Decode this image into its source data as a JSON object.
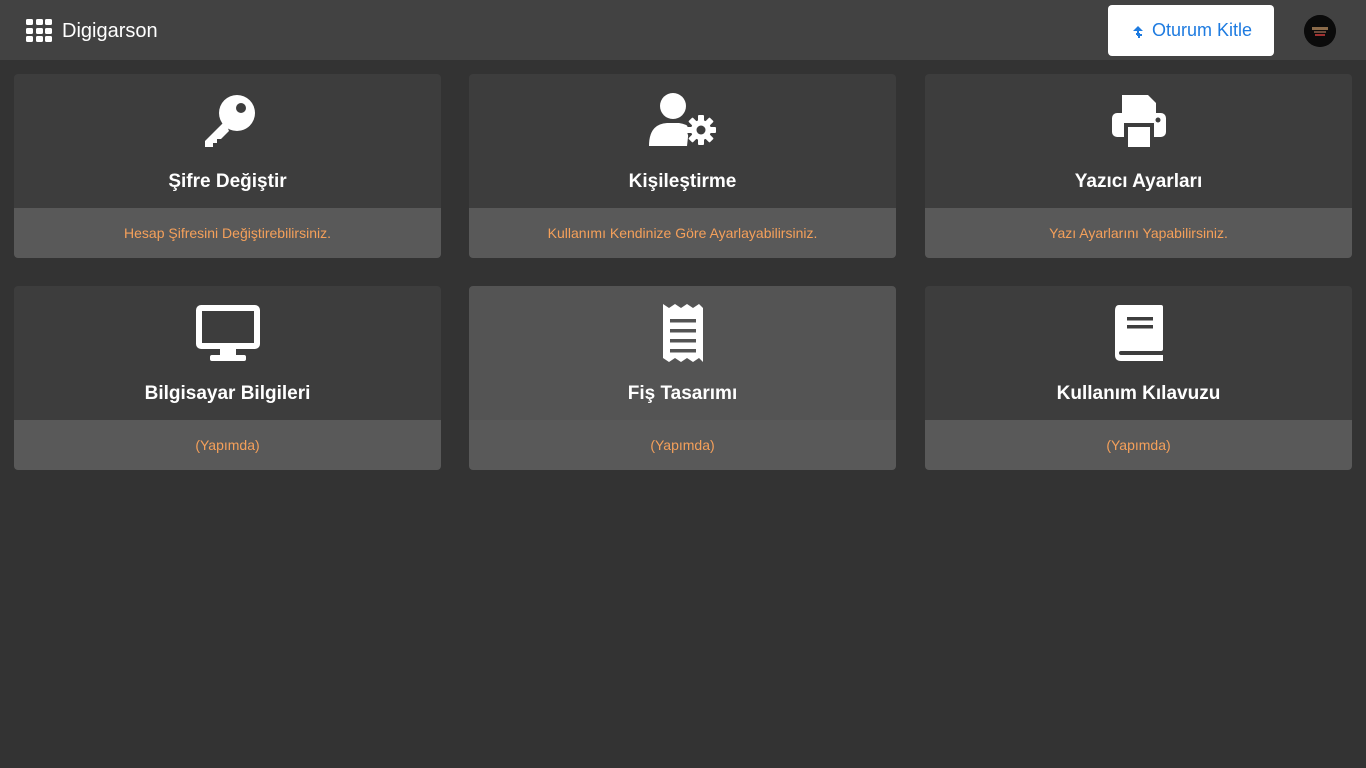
{
  "header": {
    "app_name": "Digigarson",
    "lock_button_label": "Oturum Kitle"
  },
  "colors": {
    "topbar": "#424242",
    "background": "#333333",
    "card": "#3d3d3d",
    "card_active": "#545454",
    "card_footer": "#595959",
    "accent_text": "#f5a05a",
    "button_text": "#1e7be0"
  },
  "cards": [
    {
      "title": "Şifre Değiştir",
      "subtitle": "Hesap Şifresini Değiştirebilirsiniz.",
      "icon": "key-icon"
    },
    {
      "title": "Kişileştirme",
      "subtitle": "Kullanımı Kendinize Göre Ayarlayabilirsiniz.",
      "icon": "user-gear-icon"
    },
    {
      "title": "Yazıcı Ayarları",
      "subtitle": "Yazı Ayarlarını Yapabilirsiniz.",
      "icon": "printer-icon"
    },
    {
      "title": "Bilgisayar Bilgileri",
      "subtitle": "(Yapımda)",
      "icon": "monitor-icon"
    },
    {
      "title": "Fiş Tasarımı",
      "subtitle": "(Yapımda)",
      "icon": "receipt-icon"
    },
    {
      "title": "Kullanım Kılavuzu",
      "subtitle": "(Yapımda)",
      "icon": "book-icon"
    }
  ]
}
